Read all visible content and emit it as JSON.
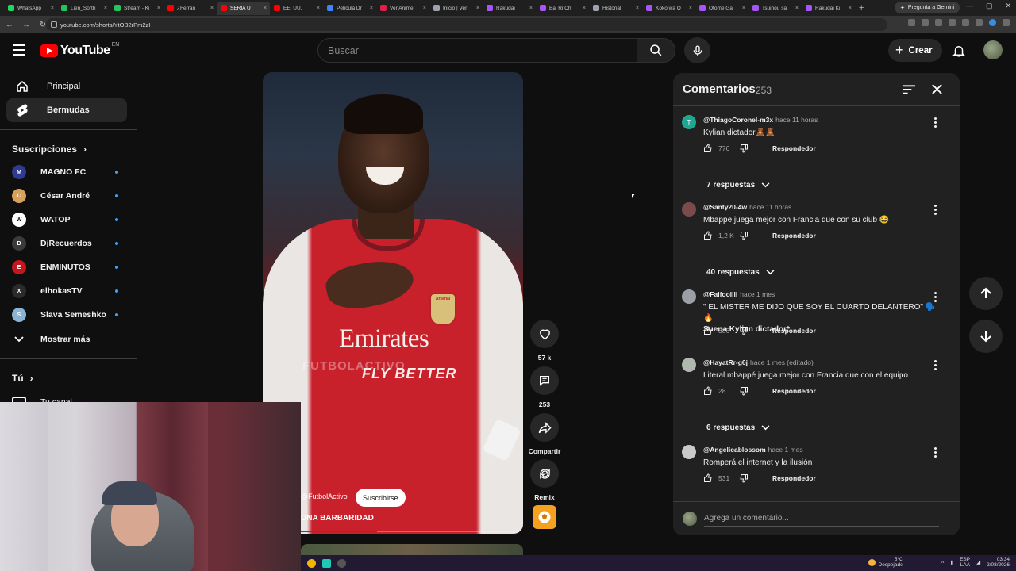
{
  "browser": {
    "tabs": [
      {
        "title": "WhatsApp",
        "fav": "#25d366"
      },
      {
        "title": "Lien_Sorth",
        "fav": "#22c55e"
      },
      {
        "title": "Stream - Ki",
        "fav": "#22c55e"
      },
      {
        "title": "¿Ferran",
        "fav": "#ff0000"
      },
      {
        "title": "SERIA U",
        "fav": "#ff0000"
      },
      {
        "title": "EE. UU.",
        "fav": "#ff0000"
      },
      {
        "title": "Película Dr",
        "fav": "#4285f4"
      },
      {
        "title": "Ver Anime",
        "fav": "#e11d48"
      },
      {
        "title": "Inicio | Ver",
        "fav": "#9ca3af"
      },
      {
        "title": "Rakudai",
        "fav": "#a855f7"
      },
      {
        "title": "Bai Ri Ch",
        "fav": "#a855f7"
      },
      {
        "title": "Historial",
        "fav": "#9ca3af"
      },
      {
        "title": "Koko wa O",
        "fav": "#a855f7"
      },
      {
        "title": "Otome Ga",
        "fav": "#a855f7"
      },
      {
        "title": "Tsuihou sa",
        "fav": "#a855f7"
      },
      {
        "title": "Rakudai Ki",
        "fav": "#a855f7"
      }
    ],
    "active_tab_index": 4,
    "new_tab_glyph": "+",
    "gemini_label": "Pregunta a Gemini",
    "url": "youtube.com/shorts/YtOB2rPm2zI"
  },
  "header": {
    "logo_text": "YouTube",
    "country_code": "EN",
    "search_placeholder": "Buscar",
    "create_label": "Crear"
  },
  "sidebar": {
    "main": [
      {
        "label": "Principal",
        "icon": "home-icon"
      },
      {
        "label": "Bermudas",
        "icon": "shorts-icon"
      }
    ],
    "subscriptions_heading": "Suscripciones",
    "subscriptions": [
      {
        "name": "MAGNO FC",
        "color": "#2f3b8f",
        "initial": "M"
      },
      {
        "name": "César André",
        "color": "#d9a05b",
        "initial": "C"
      },
      {
        "name": "WATOP",
        "color": "#ffffff",
        "initial": "W"
      },
      {
        "name": "DjRecuerdos",
        "color": "#3a3a3a",
        "initial": "D"
      },
      {
        "name": "ENMINUTOS",
        "color": "#c4161c",
        "initial": "E"
      },
      {
        "name": "elhokasTV",
        "color": "#2b2b2b",
        "initial": "X"
      },
      {
        "name": "Slava Semeshko",
        "color": "#8ab3d6",
        "initial": "S"
      }
    ],
    "show_more": "Mostrar más",
    "you_heading": "Tú",
    "your_channel": "Tu canal"
  },
  "video": {
    "sponsor_line1": "Emirates",
    "sponsor_line2": "FLY BETTER",
    "club_badge": "Arsenal",
    "watermark": "FUTBOLACTIVO",
    "channel_handle": "@FutbolActivo",
    "subscribe_label": "Suscribirse",
    "caption": "UNA BARBARIDAD",
    "progress_fraction": 0.44
  },
  "actions": {
    "likes": "57 k",
    "comments": "253",
    "share": "Compartir",
    "remix": "Remix"
  },
  "comments_panel": {
    "title": "Comentarios",
    "count": "253",
    "reply_label": "Respondedor",
    "input_placeholder": "Agrega un comentario...",
    "items": [
      {
        "author": "@ThiagoCoronel-m3x",
        "time": "hace 11 horas",
        "text": "Kylian dictador🧸🧸",
        "text2": "",
        "likes": "776",
        "avatar_color": "#1ea891",
        "initial": "T",
        "replies": "7 respuestas"
      },
      {
        "author": "@Santy20-4w",
        "time": "hace 11 horas",
        "text": "Mbappe juega mejor con Francia que con su club 😂",
        "text2": "",
        "likes": "1,2 K",
        "avatar_color": "#7b4b4b",
        "initial": "",
        "replies": "40 respuestas"
      },
      {
        "author": "@Falfoollll",
        "time": "hace 1 mes",
        "text": "\" EL MISTER ME DIJO QUE SOY EL CUARTO DELANTERO\" 🗣️🔥",
        "text2": "Suena Kylian dictador*",
        "likes": "386",
        "avatar_color": "#9aa0a6",
        "initial": "",
        "replies": ""
      },
      {
        "author": "@HayatRr-g6j",
        "time": "hace 1 mes (editado)",
        "text": "Literal mbappé juega mejor con Francia que con el equipo",
        "text2": "",
        "likes": "28",
        "avatar_color": "#b0b8b0",
        "initial": "",
        "replies": "6 respuestas"
      },
      {
        "author": "@Angelicablossom",
        "time": "hace 1 mes",
        "text": "Romperá el internet y la ilusión",
        "text2": "",
        "likes": "531",
        "avatar_color": "#c9c9c9",
        "initial": "",
        "replies": ""
      }
    ]
  },
  "taskbar": {
    "temperature": "5°C",
    "weather": "Despejado",
    "lang1": "ESP",
    "lang2": "LAA",
    "time": "03:34",
    "date": "2/08/2026"
  }
}
